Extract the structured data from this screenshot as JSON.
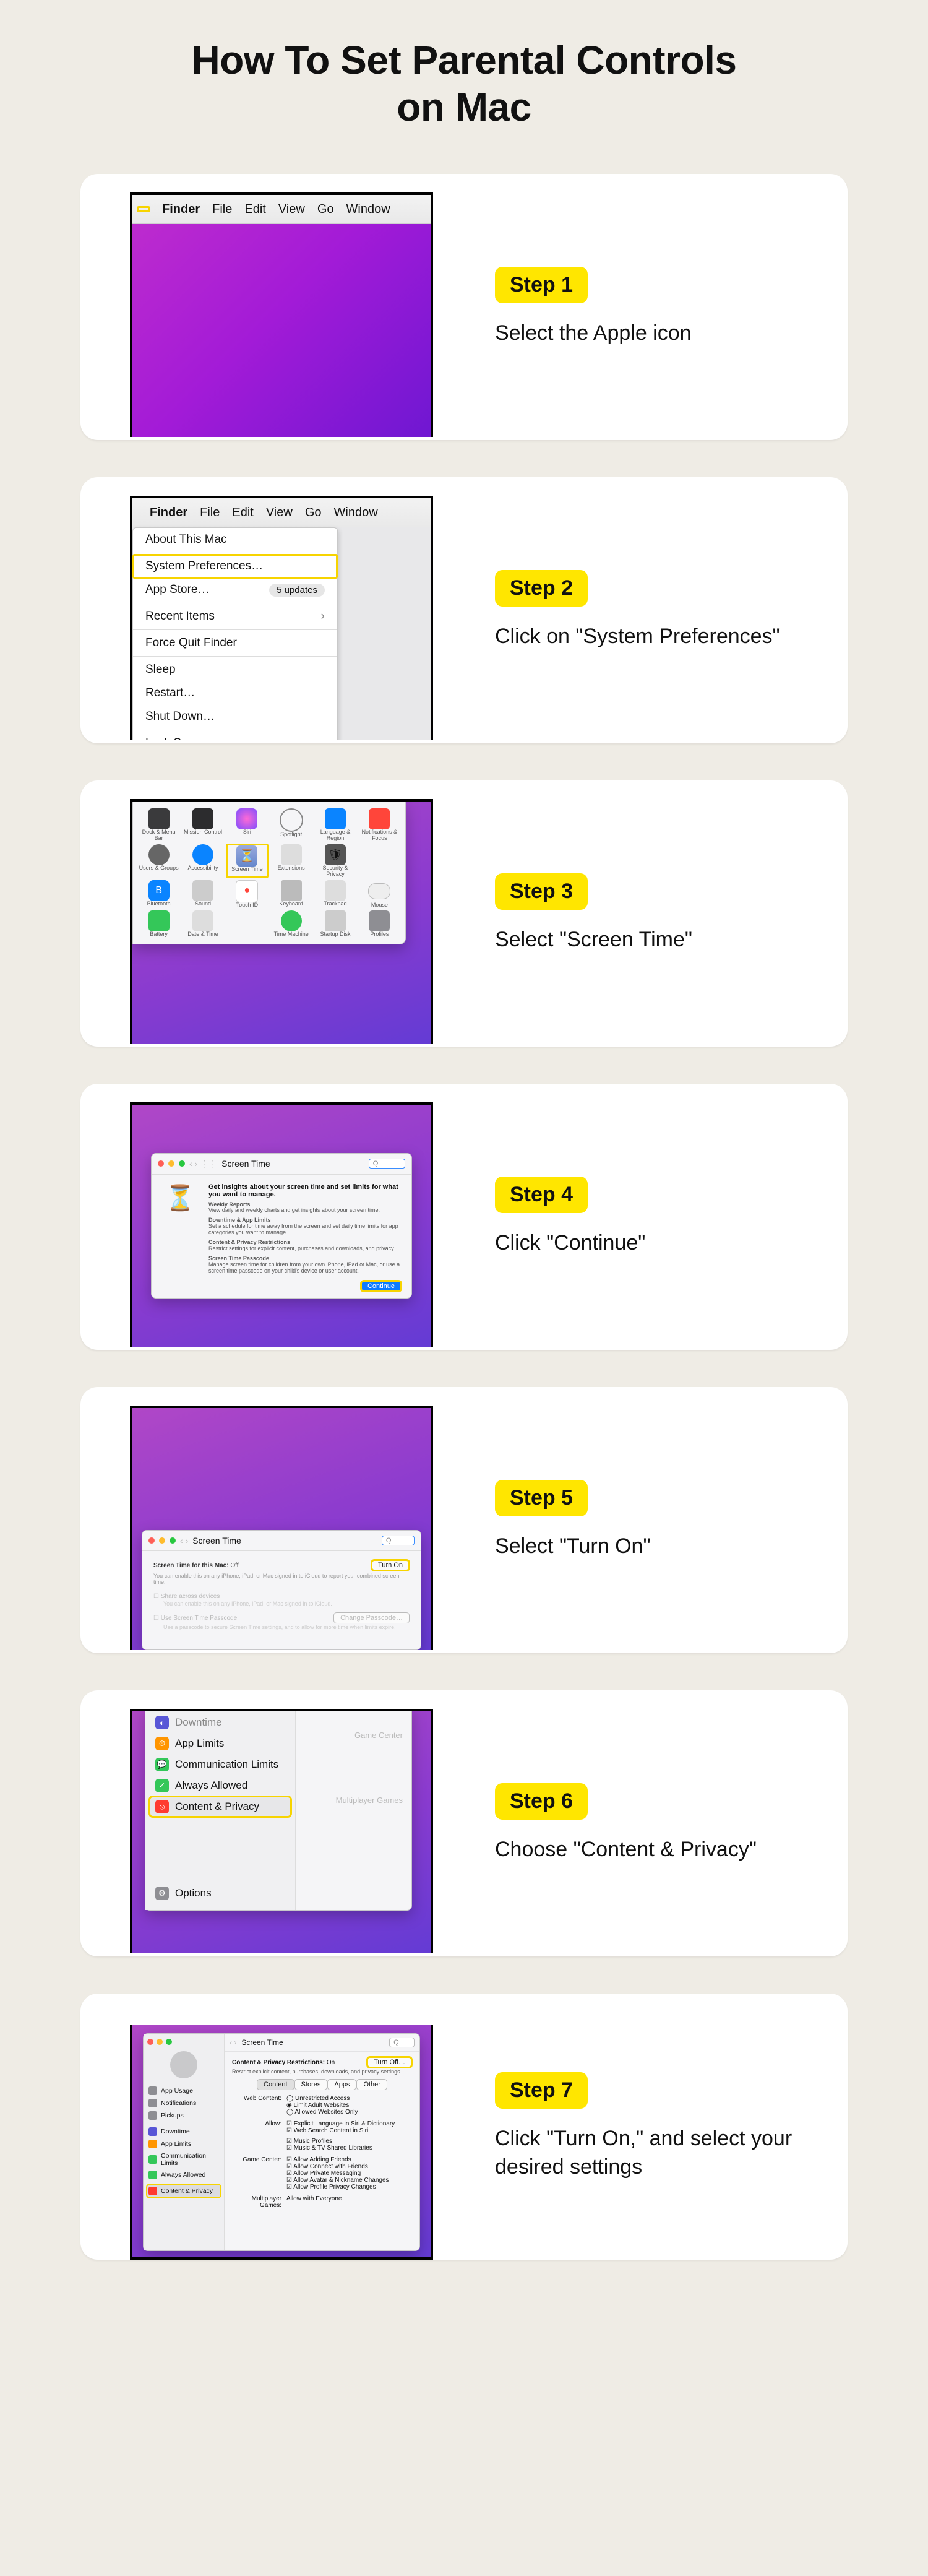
{
  "title_line1": "How To Set Parental Controls",
  "title_line2": "on Mac",
  "menubar": {
    "apple": "",
    "items": [
      "Finder",
      "File",
      "Edit",
      "View",
      "Go",
      "Window"
    ]
  },
  "apple_menu": {
    "about": "About This Mac",
    "sysprefs": "System Preferences…",
    "appstore": "App Store…",
    "updates": "5 updates",
    "recent": "Recent Items",
    "force": "Force Quit Finder",
    "sleep": "Sleep",
    "restart": "Restart…",
    "shutdown": "Shut Down…",
    "lock": "Lock Screen"
  },
  "sysprefs_icons": [
    [
      "Dock & Menu Bar",
      "Mission Control",
      "Siri",
      "Spotlight",
      "Language & Region",
      "Notifications & Focus"
    ],
    [
      "Users & Groups",
      "Accessibility",
      "Screen Time",
      "Extensions",
      "Security & Privacy",
      ""
    ],
    [
      "Bluetooth",
      "Sound",
      "Touch ID",
      "Keyboard",
      "Trackpad",
      "Mouse"
    ],
    [
      "Battery",
      "Date & Time",
      "",
      "Time Machine",
      "Startup Disk",
      "Profiles"
    ]
  ],
  "screentime_intro": {
    "title": "Screen Time",
    "headline": "Get insights about your screen time and set limits for what you want to manage.",
    "s1h": "Weekly Reports",
    "s1": "View daily and weekly charts and get insights about your screen time.",
    "s2h": "Downtime & App Limits",
    "s2": "Set a schedule for time away from the screen and set daily time limits for app categories you want to manage.",
    "s3h": "Content & Privacy Restrictions",
    "s3": "Restrict settings for explicit content, purchases and downloads, and privacy.",
    "s4h": "Screen Time Passcode",
    "s4": "Manage screen time for children from your own iPhone, iPad or Mac, or use a screen time passcode on your child's device or user account.",
    "continue": "Continue"
  },
  "screentime_options": {
    "title": "Screen Time",
    "hdr": "Screen Time for this Mac:",
    "state": "Off",
    "turnon": "Turn On",
    "line1": "You can enable this on any iPhone, iPad, or Mac signed in to iCloud to report your combined screen time.",
    "opt1": "Share across devices",
    "opt1d": "You can enable this on any iPhone, iPad, or Mac signed in to iCloud.",
    "opt2": "Use Screen Time Passcode",
    "change": "Change Passcode…",
    "opt2d": "Use a passcode to secure Screen Time settings, and to allow for more time when limits expire."
  },
  "sidebar6": {
    "pre": "Downtime",
    "items": [
      {
        "ico": "⏱",
        "col": "#ff9500",
        "lbl": "App Limits"
      },
      {
        "ico": "💬",
        "col": "#34c759",
        "lbl": "Communication Limits"
      },
      {
        "ico": "✓",
        "col": "#34c759",
        "lbl": "Always Allowed"
      },
      {
        "ico": "⦸",
        "col": "#ff3b30",
        "lbl": "Content & Privacy"
      }
    ],
    "opts": {
      "ico": "⚙︎",
      "col": "#8e8e93",
      "lbl": "Options"
    },
    "right": [
      "Game Center",
      "Multiplayer Games"
    ]
  },
  "step7win": {
    "head": "Content & Privacy Restrictions:",
    "state": "On",
    "turn": "Turn Off…",
    "sub": "Restrict explicit content, purchases, downloads, and privacy settings.",
    "tabs": [
      "Content",
      "Stores",
      "Apps",
      "Other"
    ],
    "g1": "Web Content:",
    "g1o": [
      "Unrestricted Access",
      "Limit Adult Websites",
      "Allowed Websites Only"
    ],
    "g2": "Allow:",
    "g2o": [
      "Explicit Language in Siri & Dictionary",
      "Web Search Content in Siri"
    ],
    "g3": "",
    "g3o": [
      "Music Profiles",
      "Music & TV Shared Libraries"
    ],
    "g4": "Game Center:",
    "g4o": [
      "Allow Adding Friends",
      "Allow Connect with Friends",
      "Allow Private Messaging",
      "Allow Avatar & Nickname Changes",
      "Allow Profile Privacy Changes"
    ],
    "g5": "Multiplayer Games:",
    "g5o": "Allow with Everyone",
    "side": [
      {
        "col": "#8e8e93",
        "lbl": "App Usage"
      },
      {
        "col": "#8e8e93",
        "lbl": "Notifications"
      },
      {
        "col": "#8e8e93",
        "lbl": "Pickups"
      },
      {
        "col": "#5856d6",
        "lbl": "Downtime"
      },
      {
        "col": "#ff9500",
        "lbl": "App Limits"
      },
      {
        "col": "#34c759",
        "lbl": "Communication Limits"
      },
      {
        "col": "#34c759",
        "lbl": "Always Allowed"
      },
      {
        "col": "#ff3b30",
        "lbl": "Content & Privacy"
      }
    ]
  },
  "steps": [
    {
      "badge": "Step 1",
      "text": "Select the Apple icon"
    },
    {
      "badge": "Step 2",
      "text": "Click on \"System Preferences\""
    },
    {
      "badge": "Step 3",
      "text": "Select \"Screen Time\""
    },
    {
      "badge": "Step 4",
      "text": "Click \"Continue\""
    },
    {
      "badge": "Step 5",
      "text": "Select \"Turn On\""
    },
    {
      "badge": "Step 6",
      "text": "Choose \"Content & Privacy\""
    },
    {
      "badge": "Step 7",
      "text": "Click \"Turn On,\" and select your desired settings"
    }
  ]
}
